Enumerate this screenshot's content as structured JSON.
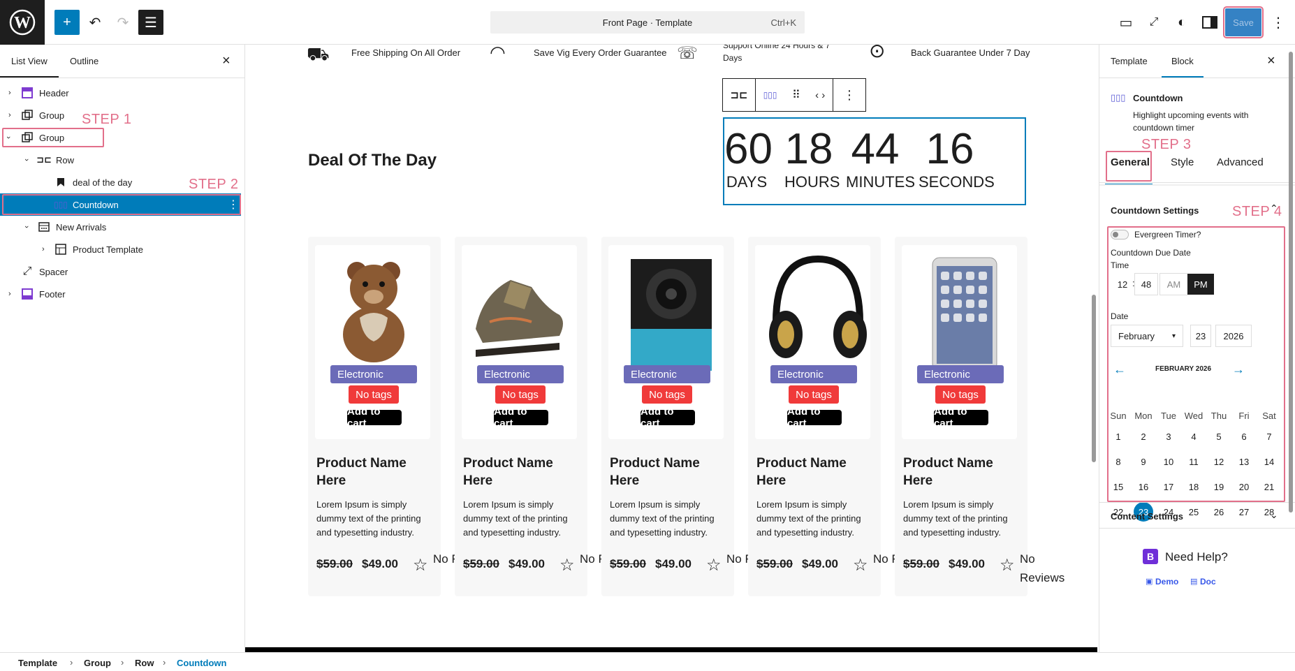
{
  "app": {
    "command_palette": {
      "label": "Front Page · Template",
      "shortcut": "Ctrl+K"
    },
    "save_label": "Save"
  },
  "left_panel": {
    "tabs": [
      "List View",
      "Outline"
    ],
    "tree": [
      {
        "label": "Header"
      },
      {
        "label": "Group"
      },
      {
        "label": "Group"
      },
      {
        "label": "Row"
      },
      {
        "label": "deal of the day"
      },
      {
        "label": "Countdown"
      },
      {
        "label": "New Arrivals"
      },
      {
        "label": "Product Template"
      },
      {
        "label": "Spacer"
      },
      {
        "label": "Footer"
      }
    ]
  },
  "steps": [
    "STEP 1",
    "STEP 2",
    "STEP 3",
    "STEP 4"
  ],
  "canvas": {
    "features": [
      "Free Shipping On All Order",
      "Save Vig Every Order Guarantee",
      "Support Online 24 Hours & 7",
      "Days",
      "Back Guarantee Under 7 Day"
    ],
    "deal_title": "Deal Of The Day",
    "countdown": [
      {
        "value": "60",
        "label": "DAYS"
      },
      {
        "value": "18",
        "label": "HOURS"
      },
      {
        "value": "44",
        "label": "MINUTES"
      },
      {
        "value": "16",
        "label": "SECONDS"
      }
    ],
    "products": [
      {
        "category": "Electronic",
        "tags": "No tags",
        "cart": "Add to cart",
        "name": "Product Name Here",
        "desc": "Lorem Ipsum is simply dummy text of the printing and typesetting industry.",
        "old_price": "$59.00",
        "new_price": "$49.00",
        "reviews": "No Rev"
      },
      {
        "category": "Electronic",
        "tags": "No tags",
        "cart": "Add to cart",
        "name": "Product Name Here",
        "desc": "Lorem Ipsum is simply dummy text of the printing and typesetting industry.",
        "old_price": "$59.00",
        "new_price": "$49.00",
        "reviews": "No Rev"
      },
      {
        "category": "Electronic",
        "tags": "No tags",
        "cart": "Add to cart",
        "name": "Product Name Here",
        "desc": "Lorem Ipsum is simply dummy text of the printing and typesetting industry.",
        "old_price": "$59.00",
        "new_price": "$49.00",
        "reviews": "No Rev"
      },
      {
        "category": "Electronic",
        "tags": "No tags",
        "cart": "Add to cart",
        "name": "Product Name Here",
        "desc": "Lorem Ipsum is simply dummy text of the printing and typesetting industry.",
        "old_price": "$59.00",
        "new_price": "$49.00",
        "reviews": "No Revi"
      },
      {
        "category": "Electronic",
        "tags": "No tags",
        "cart": "Add to cart",
        "name": "Product Name Here",
        "desc": "Lorem Ipsum is simply dummy text of the printing and typesetting industry.",
        "old_price": "$59.00",
        "new_price": "$49.00",
        "reviews": "No Reviews"
      }
    ]
  },
  "right_panel": {
    "tabs": [
      "Template",
      "Block"
    ],
    "block_name": "Countdown",
    "block_desc": "Highlight upcoming events with countdown timer",
    "sub_tabs": [
      "General",
      "Style",
      "Advanced"
    ],
    "countdown_settings": "Countdown Settings",
    "evergreen": "Evergreen Timer?",
    "due_date": "Countdown Due Date",
    "time_label": "Time",
    "hour": "12",
    "minute": "48",
    "am": "AM",
    "pm": "PM",
    "date_label": "Date",
    "month": "February",
    "day": "23",
    "year": "2026",
    "calendar_title": "FEBRUARY 2026",
    "weekdays": [
      "Sun",
      "Mon",
      "Tue",
      "Wed",
      "Thu",
      "Fri",
      "Sat"
    ],
    "days": [
      "1",
      "2",
      "3",
      "4",
      "5",
      "6",
      "7",
      "8",
      "9",
      "10",
      "11",
      "12",
      "13",
      "14",
      "15",
      "16",
      "17",
      "18",
      "19",
      "20",
      "21",
      "22",
      "23",
      "24",
      "25",
      "26",
      "27",
      "28"
    ],
    "selected_day": "23",
    "content_settings": "Content Settings",
    "need_help": "Need Help?",
    "demo": "Demo",
    "doc": "Doc"
  },
  "breadcrumb": [
    "Template",
    "Group",
    "Row",
    "Countdown"
  ],
  "colors": {
    "accent": "#007cba",
    "step": "#e26f8a",
    "category": "#6b6bb8",
    "tags": "#f03a3a"
  }
}
